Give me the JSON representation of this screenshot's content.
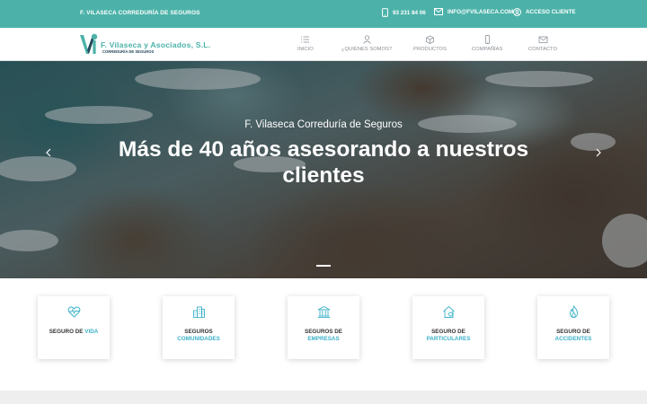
{
  "topbar": {
    "brand": "F. VILASECA CORREDURÍA DE SEGUROS",
    "phone": "93 231 84 06",
    "email": "INFO@FVILASECA.COM",
    "client": "ACCESO CLIENTE",
    "background": "#4cb2a9"
  },
  "logo": {
    "name": "F. Vilaseca y Asociados, S.L.",
    "tagline": "CORREDURÍA DE SEGUROS",
    "accent": "#4cb2a9"
  },
  "nav": [
    {
      "label": "INICIO",
      "icon": "list-icon"
    },
    {
      "label": "¿QUIÉNES SOMOS?",
      "icon": "user-icon"
    },
    {
      "label": "PRODUCTOS",
      "icon": "box-icon"
    },
    {
      "label": "COMPAÑÍAS",
      "icon": "mobile-icon"
    },
    {
      "label": "CONTACTO",
      "icon": "envelope-icon"
    }
  ],
  "hero": {
    "subtitle": "F. Vilaseca Correduría de Seguros",
    "title": "Más de 40 años asesorando  a nuestros clientes"
  },
  "cards": [
    {
      "line1": "SEGURO DE",
      "line2": "VIDA",
      "icon": "heart-pulse-icon"
    },
    {
      "line1": "SEGUROS",
      "line2": "COMUNIDADES",
      "icon": "building-icon"
    },
    {
      "line1": "SEGUROS DE",
      "line2": "EMPRESAS",
      "icon": "bank-icon"
    },
    {
      "line1": "SEGURO DE",
      "line2": "PARTICULARES",
      "icon": "house-icon"
    },
    {
      "line1": "SEGURO DE",
      "line2": "ACCIDENTES",
      "icon": "flame-icon"
    }
  ],
  "colors": {
    "accent": "#3cb1c9",
    "teal": "#4cb2a9"
  }
}
